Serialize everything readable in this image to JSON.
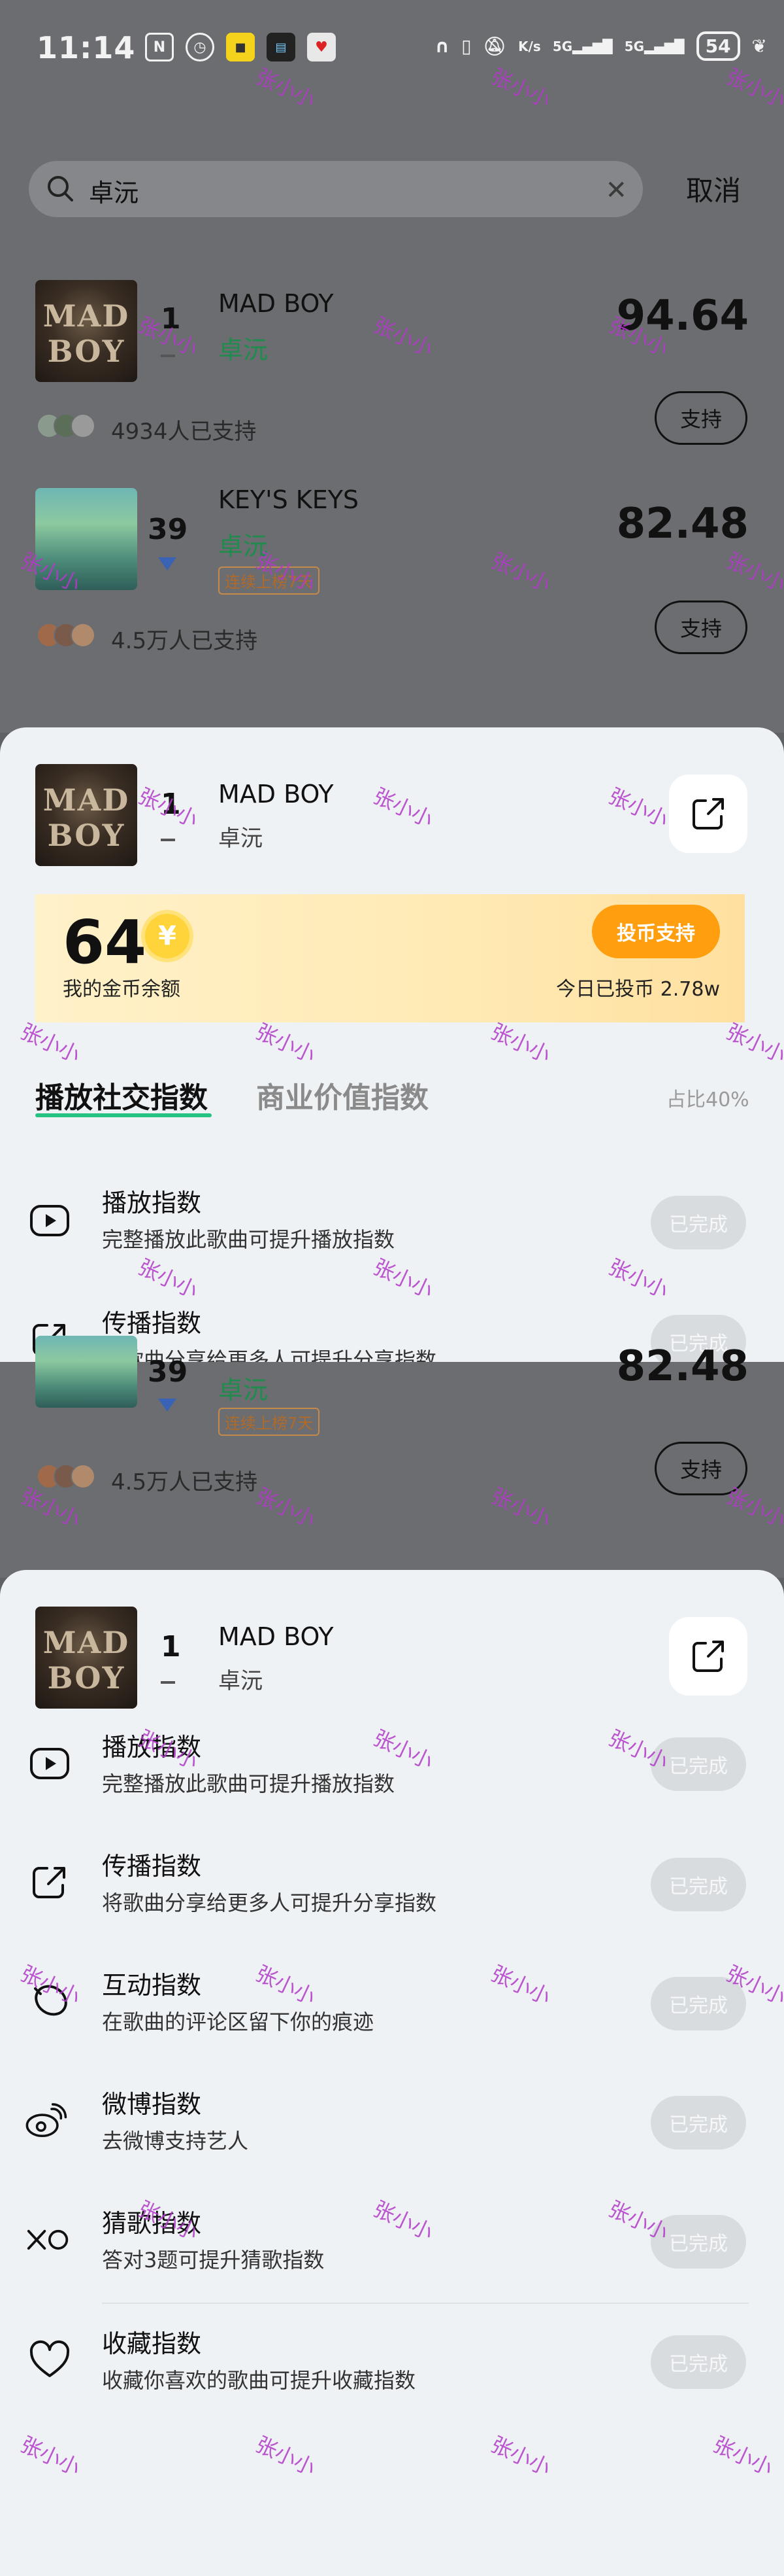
{
  "status_bar": {
    "time": "11:14",
    "icons": [
      "nfc-icon",
      "alarm-icon",
      "app-icon-1",
      "app-icon-2",
      "app-icon-3"
    ],
    "network_speed": "K/s",
    "signal_1": "5G",
    "signal_2": "5G",
    "battery": "54"
  },
  "search": {
    "query": "卓沅",
    "cancel_label": "取消"
  },
  "ranking": {
    "items": [
      {
        "rank": "1",
        "title": "MAD BOY",
        "artist": "卓沅",
        "score": "94.64",
        "supporters": "4934人已支持",
        "support_label": "支持"
      },
      {
        "rank": "39",
        "title": "KEY'S KEYS",
        "artist": "卓沅",
        "tag": "连续上榜7天",
        "score": "82.48",
        "supporters": "4.5万人已支持",
        "support_label": "支持"
      }
    ]
  },
  "cover_text": {
    "line1": "MAD",
    "line2": "BOY"
  },
  "sheet_song": {
    "rank": "1",
    "title": "MAD BOY",
    "artist": "卓沅"
  },
  "coins": {
    "balance": "64",
    "coin_symbol": "¥",
    "balance_label": "我的金币余额",
    "vote_button": "投币支持",
    "today_voted": "今日已投币 2.78w"
  },
  "tabs": {
    "active": "播放社交指数",
    "inactive": "商业价值指数",
    "ratio": "占比40%"
  },
  "tasks": [
    {
      "icon": "play-icon",
      "title": "播放指数",
      "desc": "完整播放此歌曲可提升播放指数",
      "status": "已完成"
    },
    {
      "icon": "share-icon",
      "title": "传播指数",
      "desc": "将歌曲分享给更多人可提升分享指数",
      "status": "已完成"
    },
    {
      "icon": "comment-icon",
      "title": "互动指数",
      "desc": "在歌曲的评论区留下你的痕迹",
      "status": "已完成"
    },
    {
      "icon": "weibo-icon",
      "title": "微博指数",
      "desc": "去微博支持艺人",
      "status": "已完成"
    },
    {
      "icon": "guess-icon",
      "title": "猜歌指数",
      "desc": "答对3题可提升猜歌指数",
      "status": "已完成"
    },
    {
      "icon": "heart-icon",
      "title": "收藏指数",
      "desc": "收藏你喜欢的歌曲可提升收藏指数",
      "status": "已完成"
    }
  ],
  "watermark": "张小小"
}
